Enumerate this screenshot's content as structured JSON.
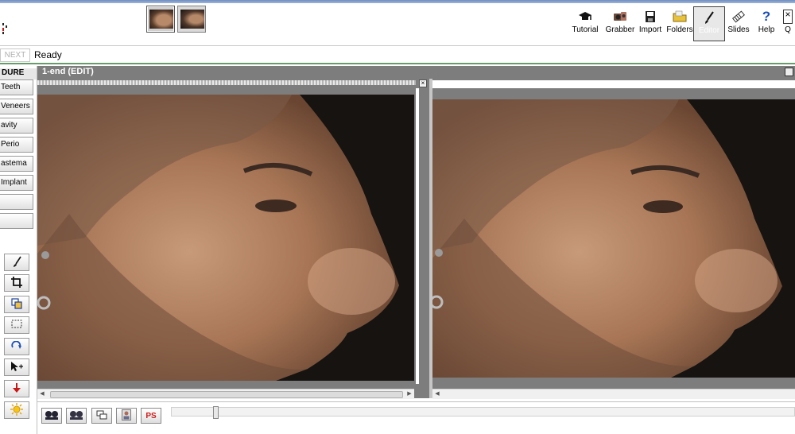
{
  "toolbar": {
    "thumbnails": [
      "face-profile-before",
      "face-profile-after"
    ],
    "buttons": [
      {
        "id": "tutorial",
        "label": "Tutorial",
        "icon": "graduation-cap-icon"
      },
      {
        "id": "grabber",
        "label": "Grabber",
        "icon": "camera-icon"
      },
      {
        "id": "import",
        "label": "Import",
        "icon": "floppy-disk-icon"
      },
      {
        "id": "folders",
        "label": "Folders",
        "icon": "folder-icon"
      },
      {
        "id": "editor",
        "label": "Editor",
        "icon": "brush-icon"
      },
      {
        "id": "slides",
        "label": "Slides",
        "icon": "slides-icon"
      },
      {
        "id": "help",
        "label": "Help",
        "icon": "question-icon"
      },
      {
        "id": "quit",
        "label": "Q",
        "icon": "close-icon"
      }
    ],
    "active": "editor"
  },
  "status": {
    "next_label": "NEXT",
    "text": "Ready"
  },
  "procedure": {
    "title": "DURE",
    "buttons": [
      "Teeth",
      "Veneers",
      "avity",
      "Perio",
      "astema",
      "Implant",
      "",
      ""
    ]
  },
  "editor": {
    "title": "1-end  (EDIT)"
  },
  "bottom": {
    "ps_label": "PS",
    "slider_value": 0.07
  },
  "colors": {
    "accent_green": "#6a9a6a",
    "header_gray": "#7d7d7d",
    "ps_red": "#d01818"
  }
}
